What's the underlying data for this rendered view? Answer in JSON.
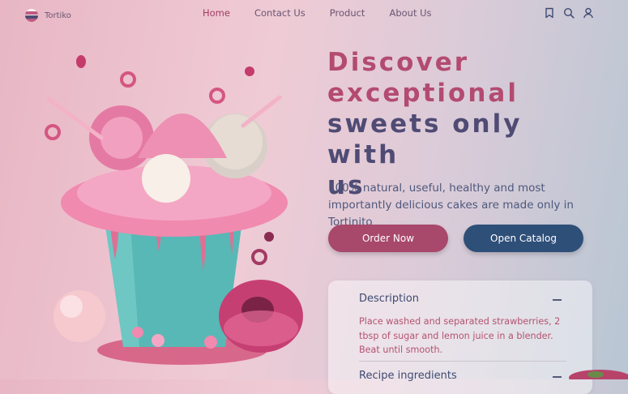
{
  "brand": {
    "name": "Tortiko"
  },
  "nav": {
    "items": [
      "Home",
      "Contact Us",
      "Product",
      "About Us"
    ],
    "active": "Home"
  },
  "icons": [
    "bookmark-icon",
    "search-icon",
    "user-icon"
  ],
  "hero": {
    "headline_line1": "Discover",
    "headline_line2": "exceptional",
    "headline_line3": "sweets only with",
    "headline_line4": "us",
    "subtitle": "100% natural, useful, healthy and most importantly delicious cakes are made only in Tortinito",
    "order_label": "Order Now",
    "catalog_label": "Open Catalog"
  },
  "recipe": {
    "title": "Description",
    "text": "Place washed and separated strawberries, 2 tbsp of sugar and lemon juice in a blender. Beat until smooth.",
    "title2": "Recipe ingredients"
  },
  "colors": {
    "accent_pink": "#a8486b",
    "accent_navy": "#2e4f78",
    "headline_pink": "#b34b70",
    "headline_navy": "#4f4b74"
  }
}
